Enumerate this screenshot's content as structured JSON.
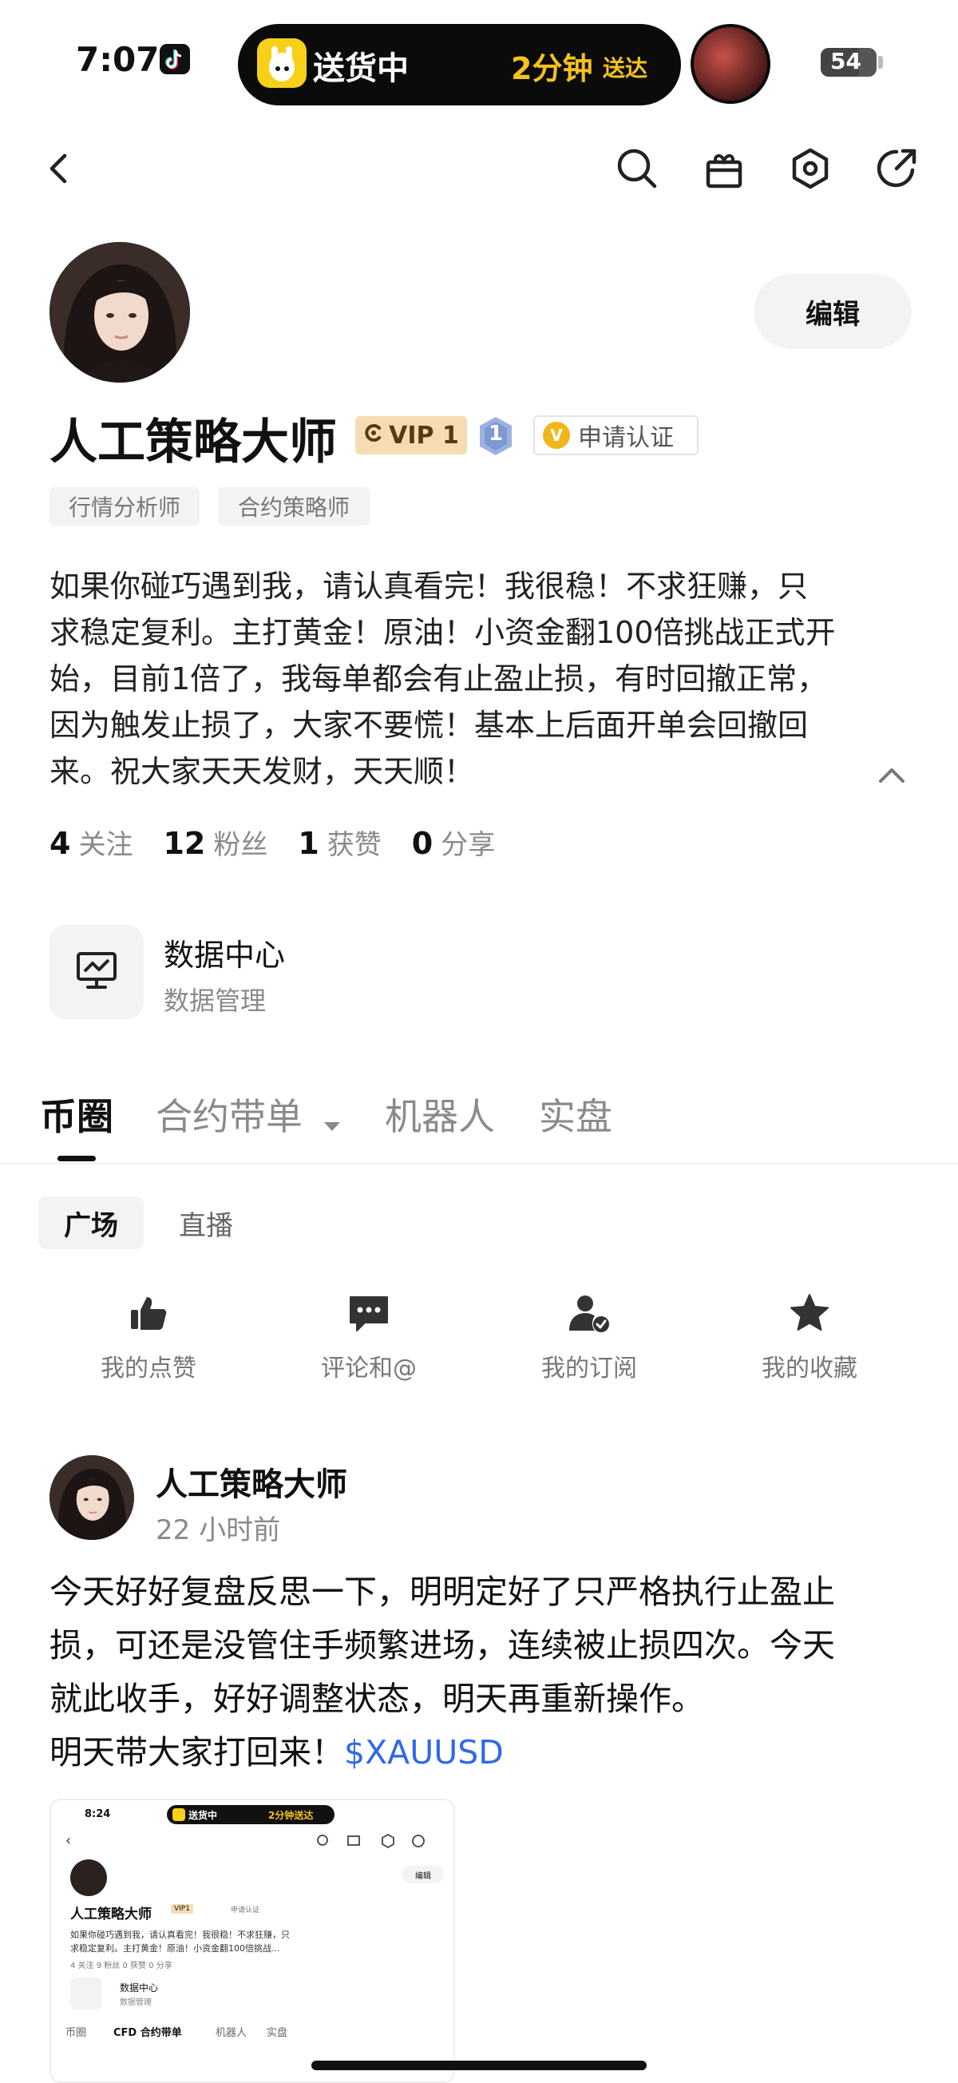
{
  "status_bar": {
    "time": "7:07",
    "island_status": "送货中",
    "island_eta": "2分钟",
    "island_eta_suffix": "送达",
    "battery": "54"
  },
  "nav": {
    "back_icon": "chevron-left-icon",
    "icons": [
      "search-icon",
      "gift-icon",
      "settings-hex-icon",
      "share-icon"
    ]
  },
  "profile": {
    "name": "人工策略大师",
    "vip_label": "VIP 1",
    "level": "1",
    "verify_label": "申请认证",
    "verify_icon_text": "V",
    "edit_label": "编辑",
    "tags": [
      "行情分析师",
      "合约策略师"
    ],
    "bio_lines": [
      "如果你碰巧遇到我，请认真看完！我很稳！不求狂赚，只",
      "求稳定复利。主打黄金！原油！小资金翻100倍挑战正式开",
      "始，目前1倍了，我每单都会有止盈止损，有时回撤正常，",
      "因为触发止损了，大家不要慌！基本上后面开单会回撤回",
      "来。祝大家天天发财，天天顺！"
    ],
    "stats": {
      "following_num": "4",
      "following_label": "关注",
      "fans_num": "12",
      "fans_label": "粉丝",
      "likes_num": "1",
      "likes_label": "获赞",
      "shares_num": "0",
      "shares_label": "分享"
    }
  },
  "data_center": {
    "title": "数据中心",
    "subtitle": "数据管理"
  },
  "tabs": {
    "coin_circle": "币圈",
    "contract_copy": "合约带单",
    "robot": "机器人",
    "live_account": "实盘"
  },
  "subtabs": {
    "plaza": "广场",
    "live": "直播"
  },
  "actions": [
    {
      "label": "我的点赞",
      "icon": "thumbs-up-icon"
    },
    {
      "label": "评论和@",
      "icon": "comment-icon"
    },
    {
      "label": "我的订阅",
      "icon": "subscribe-user-icon"
    },
    {
      "label": "我的收藏",
      "icon": "star-icon"
    }
  ],
  "post": {
    "author": "人工策略大师",
    "time": "22 小时前",
    "body_lines": [
      "今天好好复盘反思一下，明明定好了只严格执行止盈止",
      "损，可还是没管住手频繁进场，连续被止损四次。今天",
      "就此收手，好好调整状态，明天再重新操作。"
    ],
    "last_line": "明天带大家打回来！",
    "ticker": "$XAUUSD"
  },
  "thumbnail": {
    "time": "8:24",
    "island_status": "送货中",
    "island_eta": "2分钟送达",
    "name": "人工策略大师",
    "vip": "VIP1",
    "verify": "申请认证",
    "edit": "编辑",
    "bio_line1": "如果你碰巧遇到我，请认真看完！我很稳！不求狂赚，只",
    "bio_line2": "求稳定复利。主打黄金！原油！小资金翻100倍挑战...",
    "stats": "4 关注  9 粉丝  0 获赞  0 分享",
    "dc_title": "数据中心",
    "dc_sub": "数据管理",
    "tab1": "币圈",
    "tab2": "CFD 合约带单",
    "tab3": "机器人",
    "tab4": "实盘"
  }
}
